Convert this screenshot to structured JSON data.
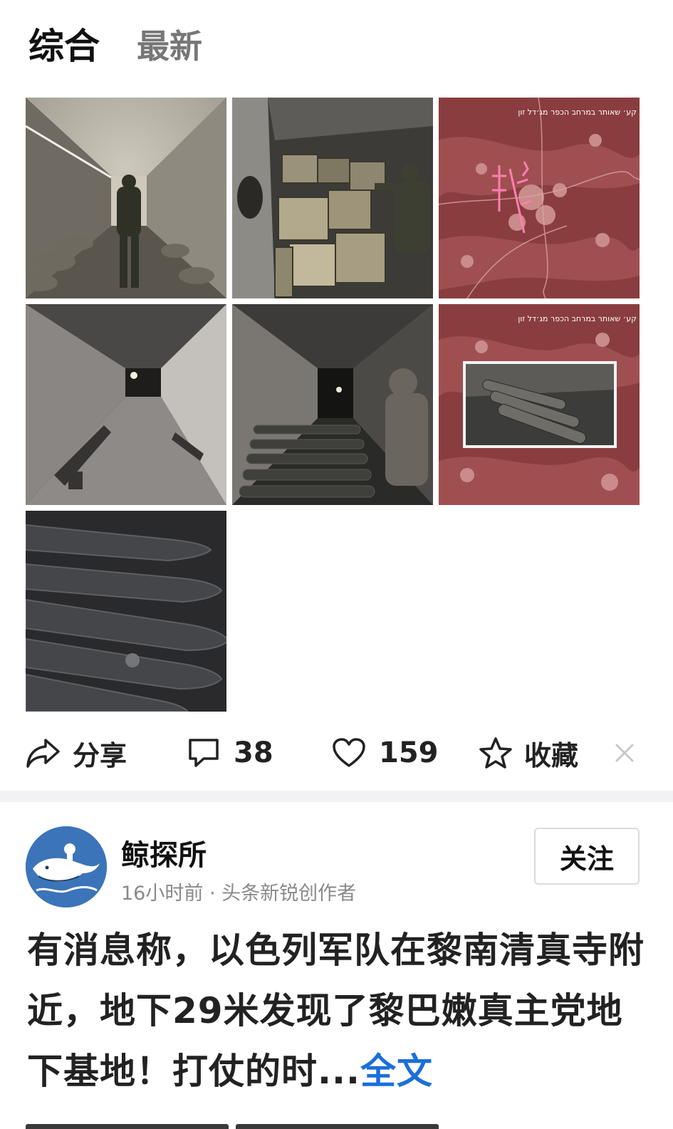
{
  "tabs": [
    {
      "label": "综合",
      "active": true
    },
    {
      "label": "最新",
      "active": false
    }
  ],
  "images": [
    {
      "name": "tunnel-soldier-photo",
      "kind": "tunnel"
    },
    {
      "name": "ammo-crates-photo",
      "kind": "crates"
    },
    {
      "name": "map-overlay-photo",
      "kind": "map",
      "caption": "קע׳ שאותר במרחב הכפר מג׳דל זון"
    },
    {
      "name": "empty-tunnel-photo",
      "kind": "tunnel-dark"
    },
    {
      "name": "tunnel-rockets-photo",
      "kind": "rockets-dark"
    },
    {
      "name": "map-inset-photo",
      "kind": "map-inset",
      "caption": "קע׳ שאותר במרחב הכפר מג׳דל זון"
    },
    {
      "name": "rockets-closeup-photo",
      "kind": "rockets-close"
    }
  ],
  "actions": {
    "share_label": "分享",
    "comment_count": "38",
    "like_count": "159",
    "favorite_label": "收藏"
  },
  "author": {
    "name": "鲸探所",
    "meta": "16小时前 · 头条新锐创作者",
    "follow_label": "关注"
  },
  "post": {
    "text": "有消息称，以色列军队在黎南清真寺附近，地下29米发现了黎巴嫩真主党地下基地！打仗的时...",
    "more_label": "全文"
  },
  "colors": {
    "link": "#1a6fd8",
    "muted": "#8a8a8a",
    "map_red": "#8a3d3f"
  }
}
